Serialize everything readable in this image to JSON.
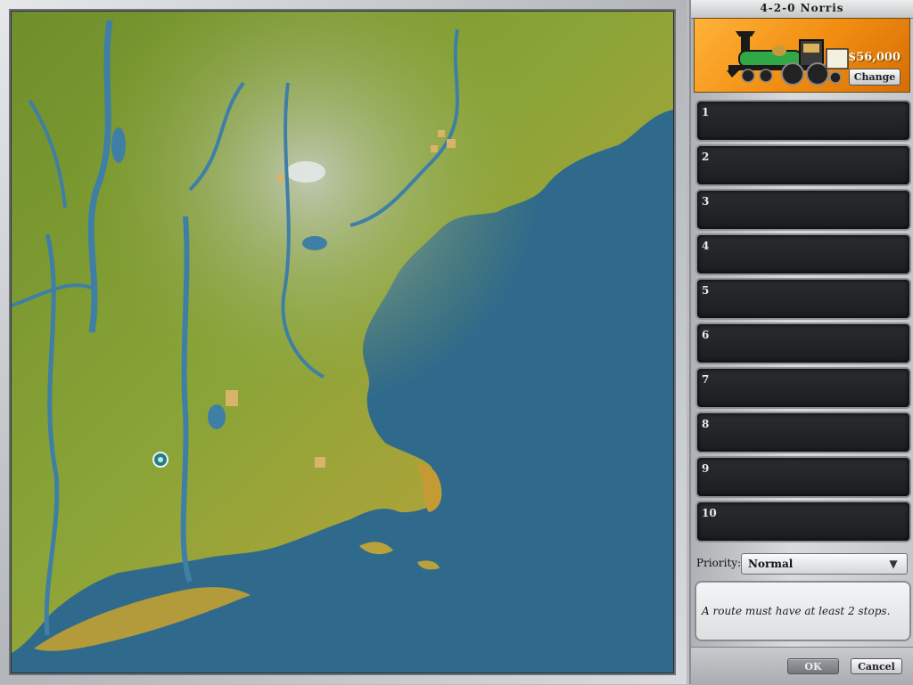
{
  "train": {
    "name": "4-2-0 Norris",
    "price": "$56,000",
    "change_label": "Change",
    "colors": {
      "card": "#f39312",
      "boiler": "#2fa845",
      "frame": "#1a1a1a"
    }
  },
  "stops": [
    {
      "number": "1"
    },
    {
      "number": "2"
    },
    {
      "number": "3"
    },
    {
      "number": "4"
    },
    {
      "number": "5"
    },
    {
      "number": "6"
    },
    {
      "number": "7"
    },
    {
      "number": "8"
    },
    {
      "number": "9"
    },
    {
      "number": "10"
    }
  ],
  "priority": {
    "label": "Priority:",
    "value": "Normal",
    "arrow_icon": "chevron-down-icon"
  },
  "message": "A route must have at least 2 stops.",
  "buttons": {
    "ok": "OK",
    "cancel": "Cancel"
  },
  "map": {
    "colors": {
      "ocean": "#2f6a8c",
      "land": "#7c9a2e",
      "coast": "#c9a23c",
      "river": "#3f7fa6"
    }
  }
}
